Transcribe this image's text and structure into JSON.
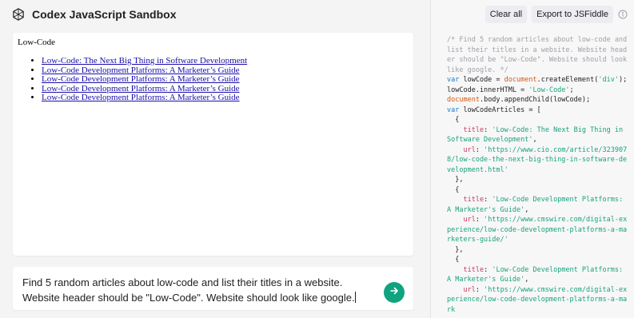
{
  "app": {
    "title": "Codex JavaScript Sandbox"
  },
  "toolbar": {
    "clear_label": "Clear all",
    "export_label": "Export to JSFiddle"
  },
  "preview": {
    "heading": "Low-Code",
    "links": [
      "Low-Code: The Next Big Thing in Software Development",
      "Low-Code Development Platforms: A Marketer’s Guide",
      "Low-Code Development Platforms: A Marketer’s Guide",
      "Low-Code Development Platforms: A Marketer’s Guide",
      "Low-Code Development Platforms: A Marketer’s Guide"
    ]
  },
  "prompt": {
    "text": "Find 5 random articles about low-code and list their titles in a website. Website header should be \"Low-Code\". Website should look like google."
  },
  "code_lines": [
    [
      {
        "c": "c",
        "t": "/* Find 5 random articles about low-code and list their titles in a website. Website header should be \"Low-Code\". Website should look like google. */"
      }
    ],
    [
      {
        "c": "k",
        "t": "var"
      },
      {
        "c": "t",
        "t": " lowCode = "
      },
      {
        "c": "b",
        "t": "document"
      },
      {
        "c": "t",
        "t": ".createElement("
      },
      {
        "c": "s",
        "t": "'div'"
      },
      {
        "c": "t",
        "t": ");"
      }
    ],
    [
      {
        "c": "t",
        "t": "lowCode.innerHTML = "
      },
      {
        "c": "s",
        "t": "'Low-Code'"
      },
      {
        "c": "t",
        "t": ";"
      }
    ],
    [
      {
        "c": "b",
        "t": "document"
      },
      {
        "c": "t",
        "t": ".body.appendChild(lowCode);"
      }
    ],
    [
      {
        "c": "k",
        "t": "var"
      },
      {
        "c": "t",
        "t": " lowCodeArticles = ["
      }
    ],
    [
      {
        "c": "t",
        "t": "  {"
      }
    ],
    [
      {
        "c": "p",
        "t": "    title"
      },
      {
        "c": "t",
        "t": ": "
      },
      {
        "c": "s",
        "t": "'Low-Code: The Next Big Thing in Software Development'"
      },
      {
        "c": "t",
        "t": ","
      }
    ],
    [
      {
        "c": "p",
        "t": "    url"
      },
      {
        "c": "t",
        "t": ": "
      },
      {
        "c": "s",
        "t": "'https://www.cio.com/article/3239078/low-code-the-next-big-thing-in-software-development.html'"
      }
    ],
    [
      {
        "c": "t",
        "t": "  },"
      }
    ],
    [
      {
        "c": "t",
        "t": "  {"
      }
    ],
    [
      {
        "c": "p",
        "t": "    title"
      },
      {
        "c": "t",
        "t": ": "
      },
      {
        "c": "s",
        "t": "'Low-Code Development Platforms: A Marketer's Guide'"
      },
      {
        "c": "t",
        "t": ","
      }
    ],
    [
      {
        "c": "p",
        "t": "    url"
      },
      {
        "c": "t",
        "t": ": "
      },
      {
        "c": "s",
        "t": "'https://www.cmswire.com/digital-experience/low-code-development-platforms-a-marketers-guide/'"
      }
    ],
    [
      {
        "c": "t",
        "t": "  },"
      }
    ],
    [
      {
        "c": "t",
        "t": "  {"
      }
    ],
    [
      {
        "c": "p",
        "t": "    title"
      },
      {
        "c": "t",
        "t": ": "
      },
      {
        "c": "s",
        "t": "'Low-Code Development Platforms: A Marketer's Guide'"
      },
      {
        "c": "t",
        "t": ","
      }
    ],
    [
      {
        "c": "p",
        "t": "    url"
      },
      {
        "c": "t",
        "t": ": "
      },
      {
        "c": "s",
        "t": "'https://www.cmswire.com/digital-experience/low-code-development-platforms-a-mark"
      }
    ]
  ],
  "colors": {
    "accent": "#10a37f",
    "link": "#1a0dab",
    "comment": "#a0a0a8",
    "keyword": "#1c7ac9",
    "builtin": "#d8580d",
    "string": "#18a37b",
    "property": "#c9385a"
  },
  "icons": {
    "logo": "openai-logo-icon",
    "submit": "arrow-right-icon",
    "info": "info-icon"
  }
}
